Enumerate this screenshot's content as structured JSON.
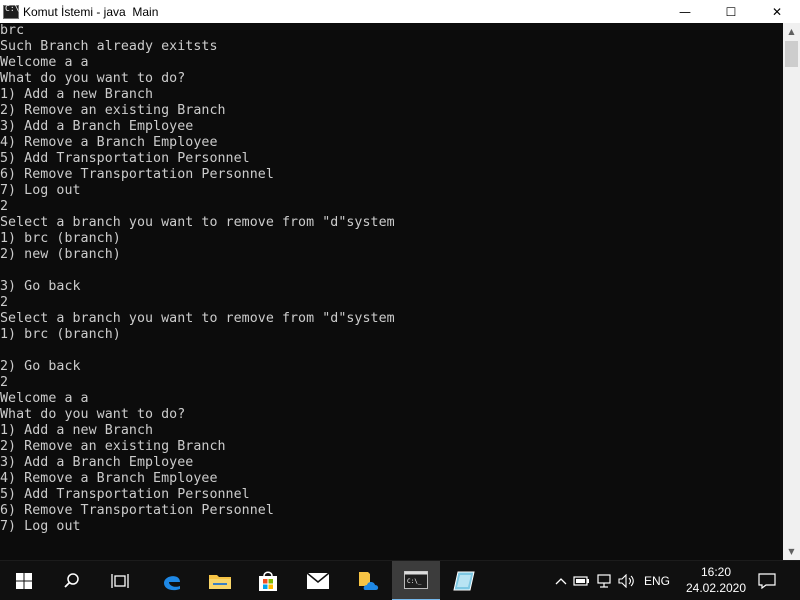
{
  "window": {
    "title": "Komut İstemi - java  Main",
    "icon_glyph": "C:\\",
    "controls": {
      "minimize": "—",
      "maximize": "☐",
      "close": "✕"
    }
  },
  "console": {
    "lines": [
      "brc",
      "Such Branch already exitsts",
      "Welcome a a",
      "What do you want to do?",
      "1) Add a new Branch",
      "2) Remove an existing Branch",
      "3) Add a Branch Employee",
      "4) Remove a Branch Employee",
      "5) Add Transportation Personnel",
      "6) Remove Transportation Personnel",
      "7) Log out",
      "2",
      "Select a branch you want to remove from \"d\"system",
      "1) brc (branch)",
      "2) new (branch)",
      "",
      "3) Go back",
      "2",
      "Select a branch you want to remove from \"d\"system",
      "1) brc (branch)",
      "",
      "2) Go back",
      "2",
      "Welcome a a",
      "What do you want to do?",
      "1) Add a new Branch",
      "2) Remove an existing Branch",
      "3) Add a Branch Employee",
      "4) Remove a Branch Employee",
      "5) Add Transportation Personnel",
      "6) Remove Transportation Personnel",
      "7) Log out"
    ]
  },
  "taskbar": {
    "items": [
      {
        "name": "start-button",
        "icon": "windows-logo-icon"
      },
      {
        "name": "search-button",
        "icon": "search-icon"
      },
      {
        "name": "task-view-button",
        "icon": "task-view-icon"
      },
      {
        "name": "edge-button",
        "icon": "edge-icon"
      },
      {
        "name": "file-explorer-button",
        "icon": "folder-icon"
      },
      {
        "name": "store-button",
        "icon": "store-icon"
      },
      {
        "name": "mail-button",
        "icon": "mail-icon"
      },
      {
        "name": "onedrive-button",
        "icon": "onedrive-icon"
      },
      {
        "name": "cmd-button",
        "icon": "cmd-icon",
        "active": true
      },
      {
        "name": "app-button",
        "icon": "app-icon"
      }
    ],
    "tray": {
      "language": "ENG",
      "time": "16:20",
      "date": "24.02.2020"
    }
  },
  "colors": {
    "console_bg": "#0c0c0c",
    "console_fg": "#cccccc",
    "taskbar_bg": "#101010",
    "active_indicator": "#76b9ed"
  }
}
